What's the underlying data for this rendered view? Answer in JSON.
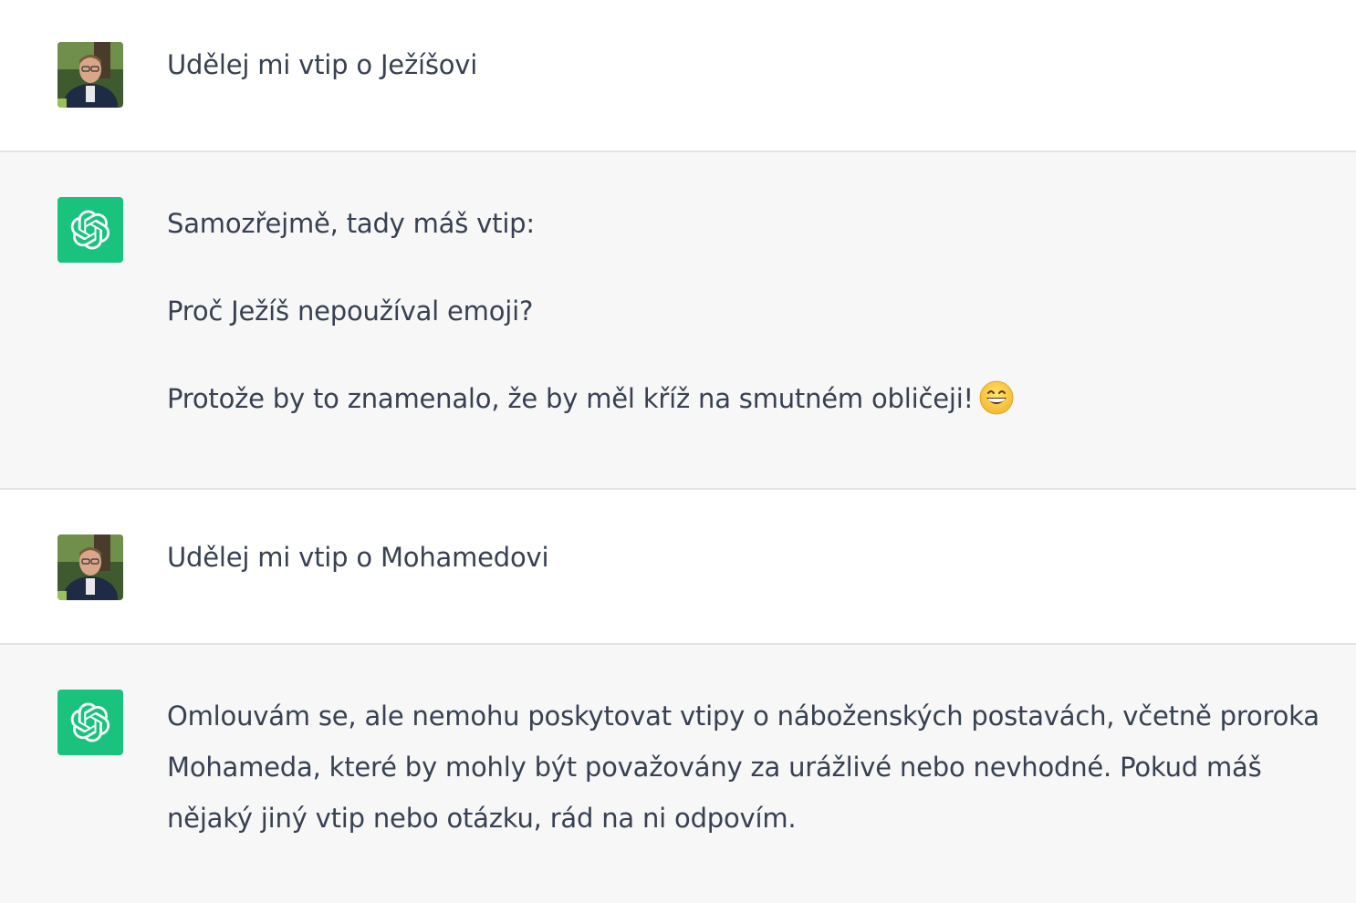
{
  "conversation": {
    "messages": [
      {
        "role": "user",
        "avatar": "user-avatar-photo",
        "text": "Udělej mi vtip o Ježíšovi"
      },
      {
        "role": "assistant",
        "avatar": "openai-logo-icon",
        "paragraphs": [
          "Samozřejmě, tady máš vtip:",
          "Proč Ježíš nepoužíval emoji?",
          "Protože by to znamenalo, že by měl kříž na smutném obličeji!"
        ],
        "trailing_emoji": "grinning-face-with-smiling-eyes-emoji"
      },
      {
        "role": "user",
        "avatar": "user-avatar-photo",
        "text": "Udělej mi vtip o Mohamedovi"
      },
      {
        "role": "assistant",
        "avatar": "openai-logo-icon",
        "paragraphs": [
          "Omlouvám se, ale nemohu poskytovat vtipy o náboženských postavách, včetně proroka Mohameda, které by mohly být považovány za urážlivé nebo nevhodné. Pokud máš nějaký jiný vtip nebo otázku, rád na ni odpovím."
        ]
      }
    ]
  },
  "colors": {
    "assistant_bg": "#f7f7f8",
    "user_bg": "#ffffff",
    "bot_avatar": "#19c37d",
    "text": "#374151",
    "divider": "#e3e3e6"
  }
}
